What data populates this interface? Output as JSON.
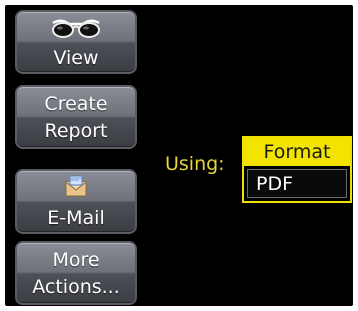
{
  "buttons": {
    "view": {
      "label": "View",
      "icon": "glasses-icon"
    },
    "create_report": {
      "line1": "Create",
      "line2": "Report"
    },
    "email": {
      "label": "E-Mail",
      "icon": "envelope-icon"
    },
    "more_actions": {
      "line1": "More",
      "line2": "Actions..."
    }
  },
  "using": {
    "label": "Using:",
    "format_header": "Format",
    "format_value": "PDF"
  },
  "colors": {
    "accent_yellow": "#f2e400",
    "label_yellow": "#e8d43a",
    "background": "#000000",
    "button_gray": "#6e7179"
  }
}
